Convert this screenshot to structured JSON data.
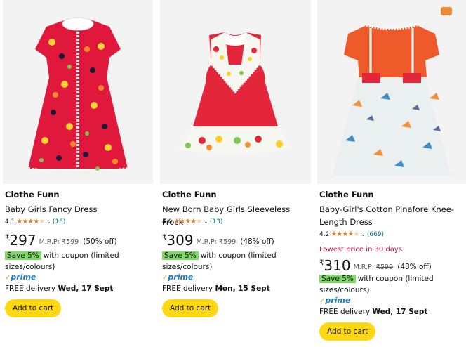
{
  "colors": {
    "accent": "#ffd814",
    "star": "#de7921",
    "link": "#007185",
    "deal": "#cc0c39",
    "coupon_badge": "#7fda69",
    "prime": "#1b7fc4"
  },
  "products": [
    {
      "brand": "Clothe Funn",
      "title": "Baby Girls Fancy Dress",
      "rating": "4.1",
      "rating_count": "(16)",
      "currency": "₹",
      "price": "297",
      "mrp_label": "M.R.P:",
      "mrp": "₹599",
      "discount": "(50% off)",
      "coupon_badge": "Save 5%",
      "coupon_text": "with coupon (limited sizes/colours)",
      "prime": "prime",
      "delivery_prefix": "FREE delivery",
      "delivery_date": "Wed, 17 Sept",
      "add_to_cart": "Add to cart"
    },
    {
      "brand": "Clothe Funn",
      "title": "New Born Baby Girls Sleeveless Frock",
      "rating": "4.0",
      "rating_count": "(13)",
      "currency": "₹",
      "price": "309",
      "mrp_label": "M.R.P:",
      "mrp": "₹599",
      "discount": "(48% off)",
      "coupon_badge": "Save 5%",
      "coupon_text": "with coupon (limited sizes/colours)",
      "prime": "prime",
      "delivery_prefix": "FREE delivery",
      "delivery_date": "Mon, 15 Sept",
      "add_to_cart": "Add to cart"
    },
    {
      "brand": "Clothe Funn",
      "title": "Baby-Girl's Cotton Pinafore Knee-Length Dress",
      "rating": "4.2",
      "rating_count": "(669)",
      "deal_text": "Lowest price in 30 days",
      "currency": "₹",
      "price": "310",
      "mrp_label": "M.R.P:",
      "mrp": "₹599",
      "discount": "(48% off)",
      "coupon_badge": "Save 5%",
      "coupon_text": "with coupon (limited sizes/colours)",
      "prime": "prime",
      "delivery_prefix": "FREE delivery",
      "delivery_date": "Wed, 17 Sept",
      "add_to_cart": "Add to cart"
    }
  ]
}
